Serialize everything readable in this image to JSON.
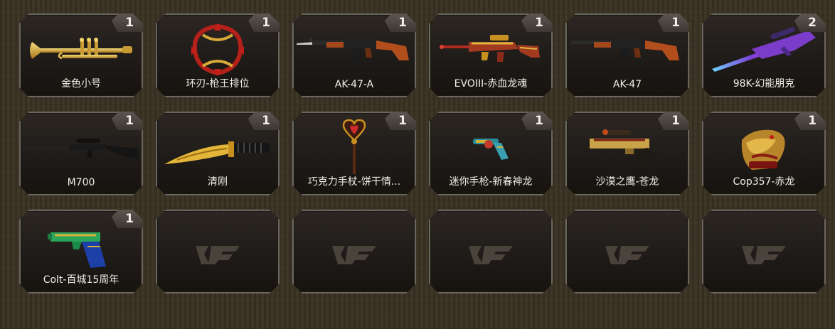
{
  "items": [
    {
      "name": "金色小号",
      "count": "1",
      "icon": "golden-trumpet-icon"
    },
    {
      "name": "环刃-枪王排位",
      "count": "1",
      "icon": "ring-blade-icon"
    },
    {
      "name": "AK-47-A",
      "count": "1",
      "icon": "ak47-bayonet-icon"
    },
    {
      "name": "EVOIII-赤血龙魂",
      "count": "1",
      "icon": "evo3-dragon-rifle-icon"
    },
    {
      "name": "AK-47",
      "count": "1",
      "icon": "ak47-icon"
    },
    {
      "name": "98K-幻能朋克",
      "count": "2",
      "icon": "98k-sniper-icon"
    },
    {
      "name": "M700",
      "count": "1",
      "icon": "m700-sniper-icon"
    },
    {
      "name": "清刚",
      "count": "1",
      "icon": "golden-knife-icon"
    },
    {
      "name": "巧克力手杖-饼干情...",
      "count": "1",
      "icon": "chocolate-cane-icon"
    },
    {
      "name": "迷你手枪-新春神龙",
      "count": "1",
      "icon": "mini-pistol-icon"
    },
    {
      "name": "沙漠之鹰-苍龙",
      "count": "1",
      "icon": "desert-eagle-icon"
    },
    {
      "name": "Cop357-赤龙",
      "count": "1",
      "icon": "cop357-dragon-icon"
    },
    {
      "name": "Colt-百城15周年",
      "count": "1",
      "icon": "colt-pistol-icon"
    }
  ],
  "empty_slots": 5,
  "empty_logo": "cf-logo-icon"
}
